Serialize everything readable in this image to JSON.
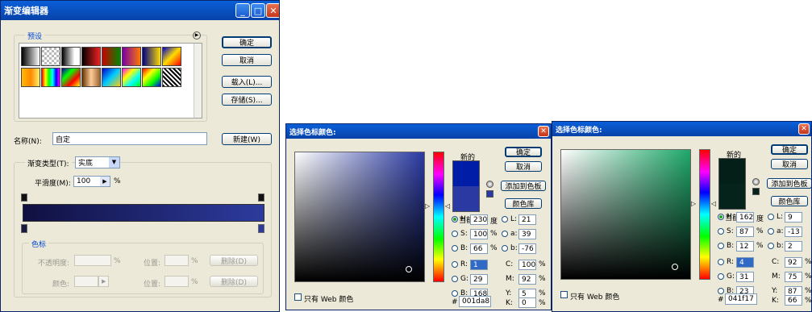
{
  "gradient_editor": {
    "title": "渐变编辑器",
    "presets_label": "预设",
    "ok": "确定",
    "cancel": "取消",
    "load": "载入(L)...",
    "save": "存储(S)...",
    "name_label": "名称(N):",
    "name_value": "自定",
    "new": "新建(W)",
    "gradient_type_label": "渐变类型(T):",
    "gradient_type_value": "实底",
    "smoothness_label": "平滑度(M):",
    "smoothness_value": "100",
    "percent": "%",
    "stops_label": "色标",
    "opacity_label": "不透明度:",
    "color_label": "颜色:",
    "location_label": "位置:",
    "delete": "删除(D)",
    "gradient_colors": [
      "#101040",
      "#2d3b9e"
    ]
  },
  "picker1": {
    "title": "选择色标颜色:",
    "new_label": "新的",
    "current_label": "当前",
    "ok": "确定",
    "cancel": "取消",
    "add_swatch": "添加到色板",
    "libraries": "颜色库",
    "web_only": "只有 Web 颜色",
    "h_label": "H:",
    "h": "230",
    "h_unit": "度",
    "s_label": "S:",
    "s": "100",
    "s_unit": "%",
    "b_label": "B:",
    "b": "66",
    "b_unit": "%",
    "r_label": "R:",
    "r": "1",
    "g_label": "G:",
    "g": "29",
    "bb_label": "B:",
    "bb": "168",
    "l_label": "L:",
    "l": "21",
    "a_label": "a:",
    "a": "39",
    "lb_label": "b:",
    "lb": "-76",
    "c_label": "C:",
    "c": "100",
    "c_unit": "%",
    "m_label": "M:",
    "m": "92",
    "m_unit": "%",
    "y_label": "Y:",
    "y": "5",
    "y_unit": "%",
    "k_label": "K:",
    "k": "0",
    "k_unit": "%",
    "hash": "#",
    "hex": "001da8",
    "color": "#001da8",
    "current_color": "#2a3aa2",
    "field_color": "#2a3aa2"
  },
  "picker2": {
    "title": "选择色标颜色:",
    "new_label": "新的",
    "current_label": "当前",
    "ok": "确定",
    "cancel": "取消",
    "add_swatch": "添加到色板",
    "libraries": "颜色库",
    "web_only": "只有 Web 颜色",
    "h_label": "H:",
    "h": "162",
    "h_unit": "度",
    "s_label": "S:",
    "s": "87",
    "s_unit": "%",
    "b_label": "B:",
    "b": "12",
    "b_unit": "%",
    "r_label": "R:",
    "r": "4",
    "g_label": "G:",
    "g": "31",
    "bb_label": "B:",
    "bb": "23",
    "l_label": "L:",
    "l": "9",
    "a_label": "a:",
    "a": "-13",
    "lb_label": "b:",
    "lb": "2",
    "c_label": "C:",
    "c": "92",
    "c_unit": "%",
    "m_label": "M:",
    "m": "75",
    "m_unit": "%",
    "y_label": "Y:",
    "y": "87",
    "y_unit": "%",
    "k_label": "K:",
    "k": "66",
    "k_unit": "%",
    "hash": "#",
    "hex": "041f17",
    "color": "#041f17",
    "current_color": "#05231a",
    "field_color": "#1fa86a"
  }
}
